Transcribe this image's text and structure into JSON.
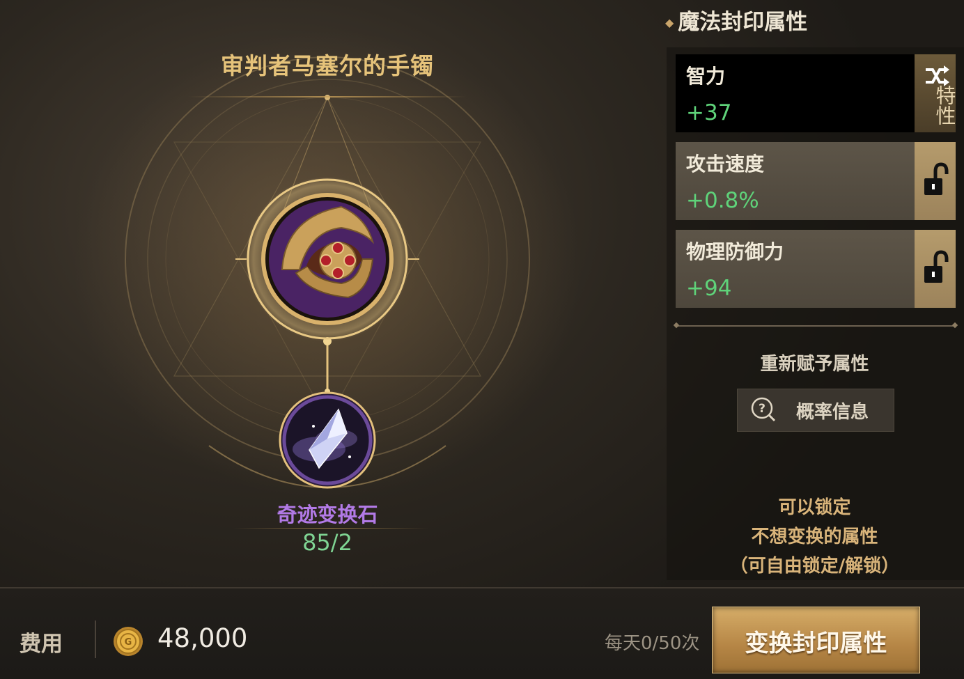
{
  "item": {
    "name": "审判者马塞尔的手镯",
    "icon": "bracelet-icon"
  },
  "material": {
    "name": "奇迹变换石",
    "count": "85/2",
    "icon": "crystal-icon"
  },
  "panel": {
    "title": "魔法封印属性",
    "attributes": [
      {
        "name": "智力",
        "value": "+37",
        "side": "trait",
        "side_label": "特性",
        "side_icon": "shuffle-icon"
      },
      {
        "name": "攻击速度",
        "value": "+0.8%",
        "side": "lock",
        "side_icon": "unlock-icon"
      },
      {
        "name": "物理防御力",
        "value": "+94",
        "side": "lock",
        "side_icon": "unlock-icon"
      }
    ],
    "reroll_label": "重新赋予属性",
    "prob_button": "概率信息",
    "hint_lines": [
      "可以锁定",
      "不想变换的属性",
      "（可自由锁定/解锁）"
    ]
  },
  "footer": {
    "cost_label": "费用",
    "cost_value": "48,000",
    "coin_icon": "gold-coin-icon",
    "daily_limit": "每天0/50次",
    "action_button": "变换封印属性"
  },
  "colors": {
    "title_gold": "#e6c37a",
    "value_green": "#5fd37a",
    "stone_purple": "#b27ae6",
    "hint_gold": "#d9b47a",
    "button_gold": "#c49552"
  }
}
